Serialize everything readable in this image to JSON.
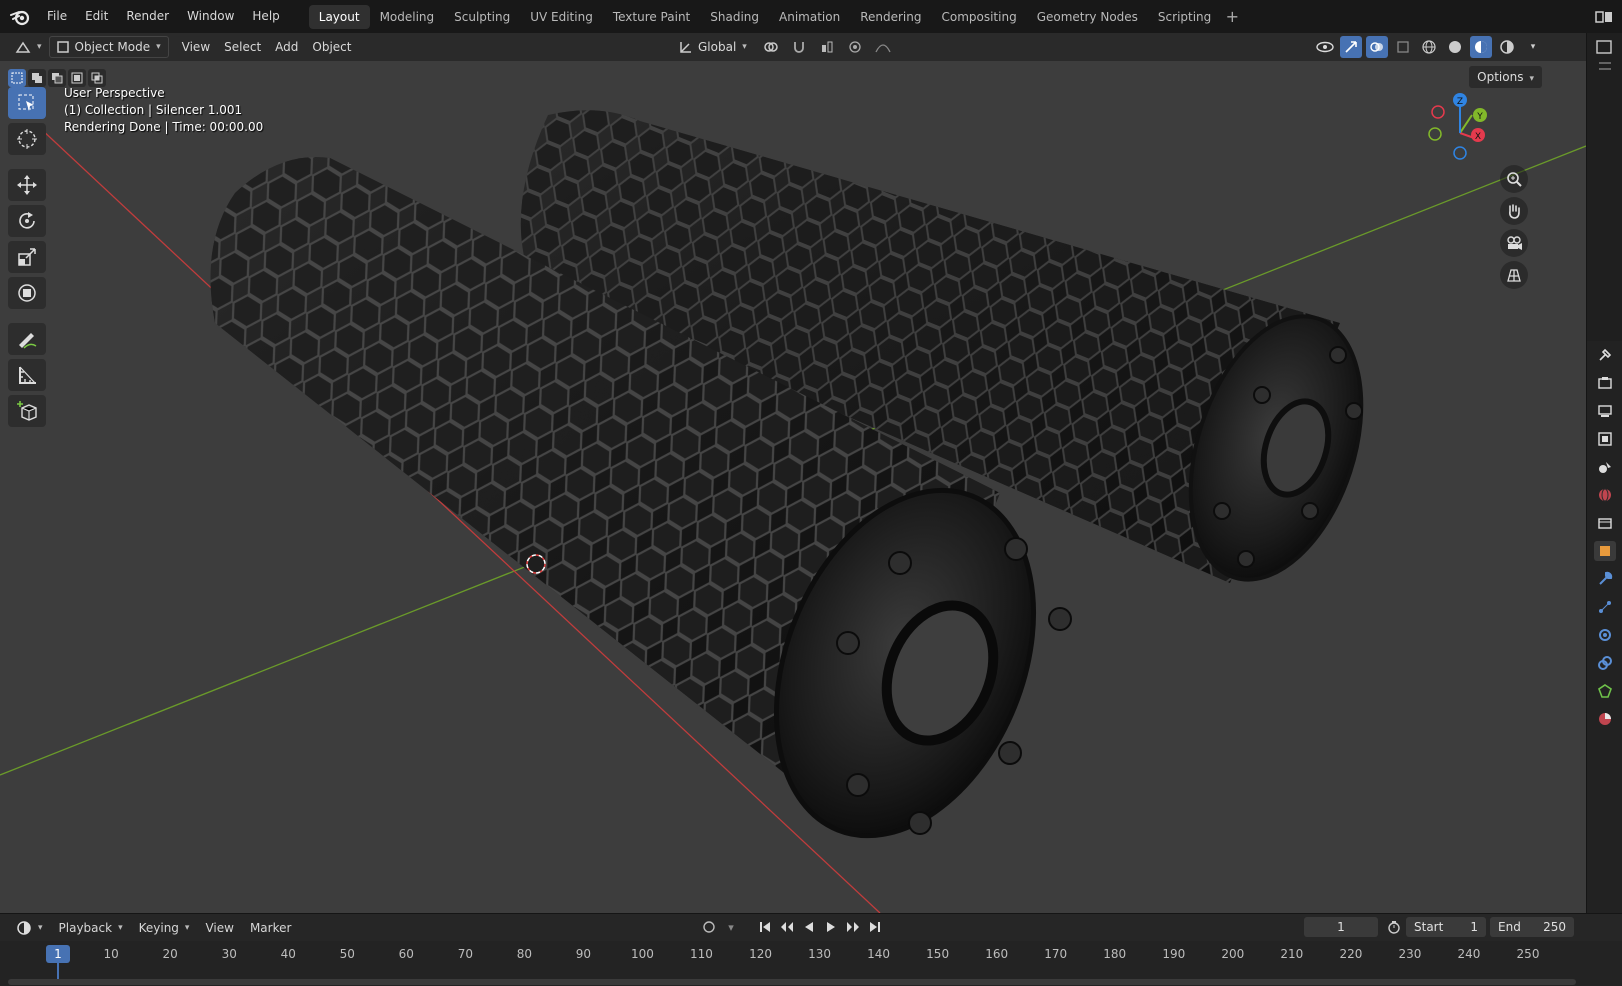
{
  "app": {
    "menus": [
      "File",
      "Edit",
      "Render",
      "Window",
      "Help"
    ],
    "workspaces": [
      "Layout",
      "Modeling",
      "Sculpting",
      "UV Editing",
      "Texture Paint",
      "Shading",
      "Animation",
      "Rendering",
      "Compositing",
      "Geometry Nodes",
      "Scripting"
    ],
    "active_workspace": "Layout"
  },
  "viewport_header": {
    "mode": "Object Mode",
    "menus": [
      "View",
      "Select",
      "Add",
      "Object"
    ],
    "orientation": "Global",
    "options_label": "Options"
  },
  "viewport_info": {
    "line1": "User Perspective",
    "line2": "(1) Collection | Silencer 1.001",
    "line3": "Rendering Done | Time: 00:00.00"
  },
  "gizmo": {
    "x": "X",
    "y": "Y",
    "z": "Z",
    "x_color": "#e53a4d",
    "y_color": "#82b82a",
    "z_color": "#2f84e3"
  },
  "timeline": {
    "menus": [
      "Playback",
      "Keying",
      "View",
      "Marker"
    ],
    "current_frame": "1",
    "start_label": "Start",
    "start_value": "1",
    "end_label": "End",
    "end_value": "250",
    "ticks": [
      "1",
      "10",
      "20",
      "30",
      "40",
      "50",
      "60",
      "70",
      "80",
      "90",
      "100",
      "110",
      "120",
      "130",
      "140",
      "150",
      "160",
      "170",
      "180",
      "190",
      "200",
      "210",
      "220",
      "230",
      "240",
      "250"
    ]
  },
  "colors": {
    "accent": "#4772b3",
    "viewport_bg": "#3d3d3d",
    "x_axis": "#c03c3c",
    "y_axis": "#6a9a2a"
  },
  "icons": {
    "tools": [
      "select-box-icon",
      "cursor-icon",
      "move-icon",
      "rotate-icon",
      "scale-icon",
      "transform-icon",
      "annotate-icon",
      "measure-icon",
      "add-cube-icon"
    ],
    "nav": [
      "zoom-icon",
      "pan-hand-icon",
      "camera-view-icon",
      "ortho-grid-icon"
    ],
    "properties": [
      "tool-icon",
      "render-icon",
      "output-icon",
      "view-layer-icon",
      "scene-icon",
      "world-icon",
      "collection-icon",
      "object-icon",
      "modifier-icon",
      "particles-icon",
      "physics-icon",
      "constraints-icon",
      "data-icon",
      "material-icon"
    ]
  }
}
